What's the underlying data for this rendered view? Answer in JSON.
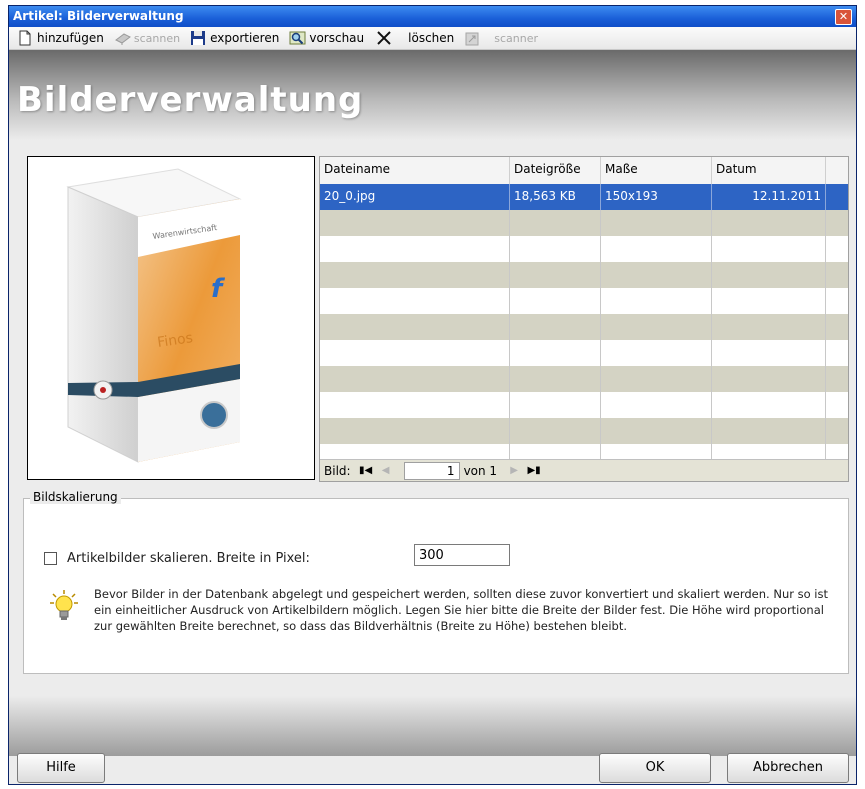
{
  "window": {
    "title": "Artikel: Bilderverwaltung",
    "close_glyph": "✕"
  },
  "toolbar": {
    "items": [
      {
        "label": "hinzufügen",
        "icon": "new-document-icon",
        "enabled": true
      },
      {
        "label": "scannen",
        "icon": "scanner-icon",
        "enabled": false
      },
      {
        "label": "exportieren",
        "icon": "save-disk-icon",
        "enabled": true
      },
      {
        "label": "vorschau",
        "icon": "preview-magnifier-icon",
        "enabled": true
      },
      {
        "label": "löschen",
        "icon": "delete-x-icon",
        "enabled": true
      },
      {
        "label": "scanner",
        "icon": "scanner-settings-icon",
        "enabled": false
      }
    ]
  },
  "header": {
    "title": "Bilderverwaltung"
  },
  "preview": {
    "box_text": "Warenwirtschaft",
    "product_text": "Finos"
  },
  "grid": {
    "columns": [
      "Dateiname",
      "Dateigröße",
      "Maße",
      "Datum"
    ],
    "rows": [
      {
        "Dateiname": "20_0.jpg",
        "Dateigröße": "18,563 KB",
        "Maße": "150x193",
        "Datum": "12.11.2011",
        "selected": true
      }
    ],
    "navigator": {
      "label": "Bild:",
      "current": "1",
      "total_text": "von 1"
    }
  },
  "scaling": {
    "legend": "Bildskalierung",
    "checkbox_label": "Artikelbilder skalieren. Breite in Pixel:",
    "checked": false,
    "width_value": "300",
    "hint": "Bevor Bilder in der Datenbank abgelegt und gespeichert werden, sollten diese zuvor konvertiert und skaliert werden. Nur so ist ein einheitlicher Ausdruck von Artikelbildern möglich. Legen Sie hier bitte die Breite der Bilder fest. Die Höhe wird proportional zur gewählten Breite berechnet, so dass das Bildverhältnis (Breite zu Höhe) bestehen bleibt."
  },
  "buttons": {
    "help": "Hilfe",
    "ok": "OK",
    "cancel": "Abbrechen"
  }
}
